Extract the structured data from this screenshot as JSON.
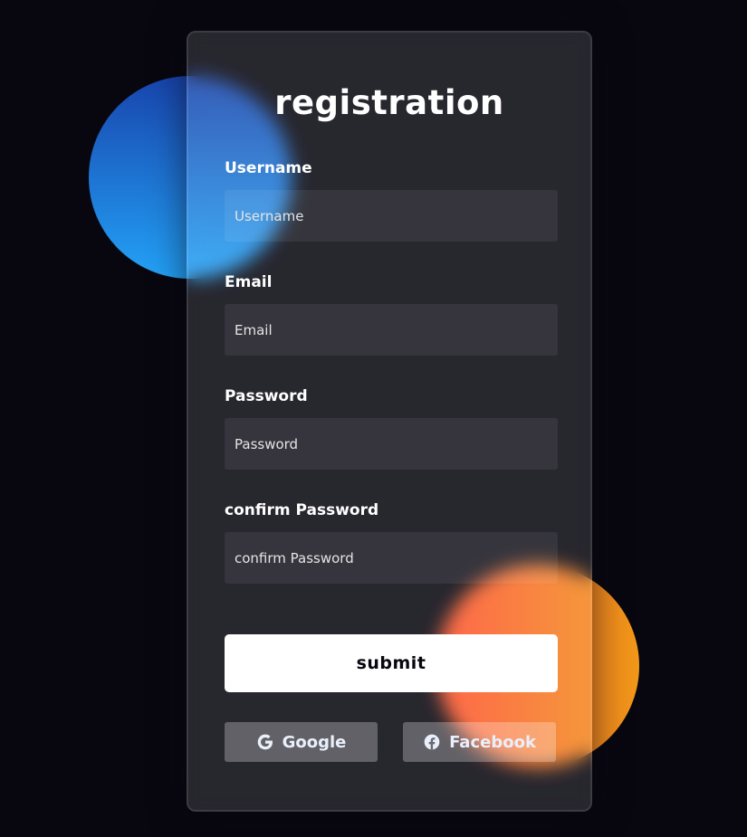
{
  "form": {
    "title": "registration",
    "fields": [
      {
        "label": "Username",
        "placeholder": "Username"
      },
      {
        "label": "Email",
        "placeholder": "Email"
      },
      {
        "label": "Password",
        "placeholder": "Password"
      },
      {
        "label": "confirm Password",
        "placeholder": "confirm Password"
      }
    ],
    "submit_label": "submit",
    "social": [
      {
        "label": "Google",
        "icon": "google-icon"
      },
      {
        "label": "Facebook",
        "icon": "facebook-icon"
      }
    ]
  },
  "colors": {
    "background": "#080710",
    "blue_gradient": [
      "#1845ad",
      "#23a2f6"
    ],
    "orange_gradient": [
      "#ff512f",
      "#f09819"
    ],
    "button": "#ffffff"
  }
}
